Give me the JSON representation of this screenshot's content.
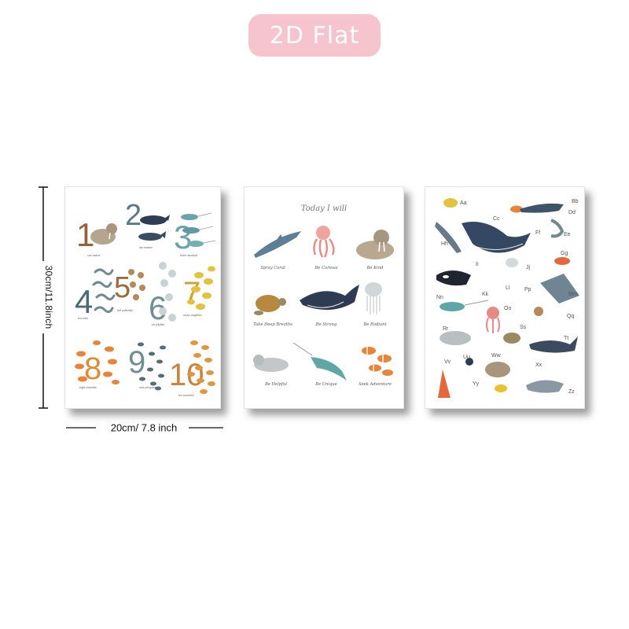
{
  "badge": {
    "label": "2D Flat"
  },
  "dimensions": {
    "height_label": "30cm/11.8inch",
    "width_label": "20cm/ 7.8 inch"
  },
  "posters": {
    "numbers": {
      "digits": [
        "1",
        "2",
        "3",
        "4",
        "5",
        "6",
        "7",
        "8",
        "9",
        "10"
      ],
      "captions": [
        "one walrus",
        "two whales",
        "three narwhals",
        "four eels",
        "five pufferfish",
        "six jellyfish",
        "seven angelfish",
        "eight clownfish",
        "nine penguins",
        "ten clownfish"
      ]
    },
    "sea_life": {
      "title": "Today I will",
      "captions": [
        "Spray Coral",
        "Be Curious",
        "Be Kind",
        "Take Deep Breaths",
        "Be Strong",
        "Be Radiant",
        "Be Helpful",
        "Be Unique",
        "Seek Adventure"
      ]
    },
    "alphabet": {
      "letters": [
        "Aa",
        "Bb",
        "Cc",
        "Dd",
        "Ee",
        "Ff",
        "Gg",
        "Hh",
        "Ii",
        "Jj",
        "Kk",
        "Ll",
        "Mm",
        "Nn",
        "Oo",
        "Pp",
        "Qq",
        "Rr",
        "Ss",
        "Tt",
        "Uu",
        "Vv",
        "Ww",
        "Xx",
        "Yy",
        "Zz"
      ]
    }
  },
  "colors": {
    "badge_bg": "#f6c4cf",
    "brown": "#9a5f3c",
    "slate": "#4e6b73",
    "teal": "#5fa7a6",
    "mustard": "#c9a43a",
    "orange": "#e28a3a",
    "navy": "#2f3d52",
    "coral": "#e58a84"
  }
}
